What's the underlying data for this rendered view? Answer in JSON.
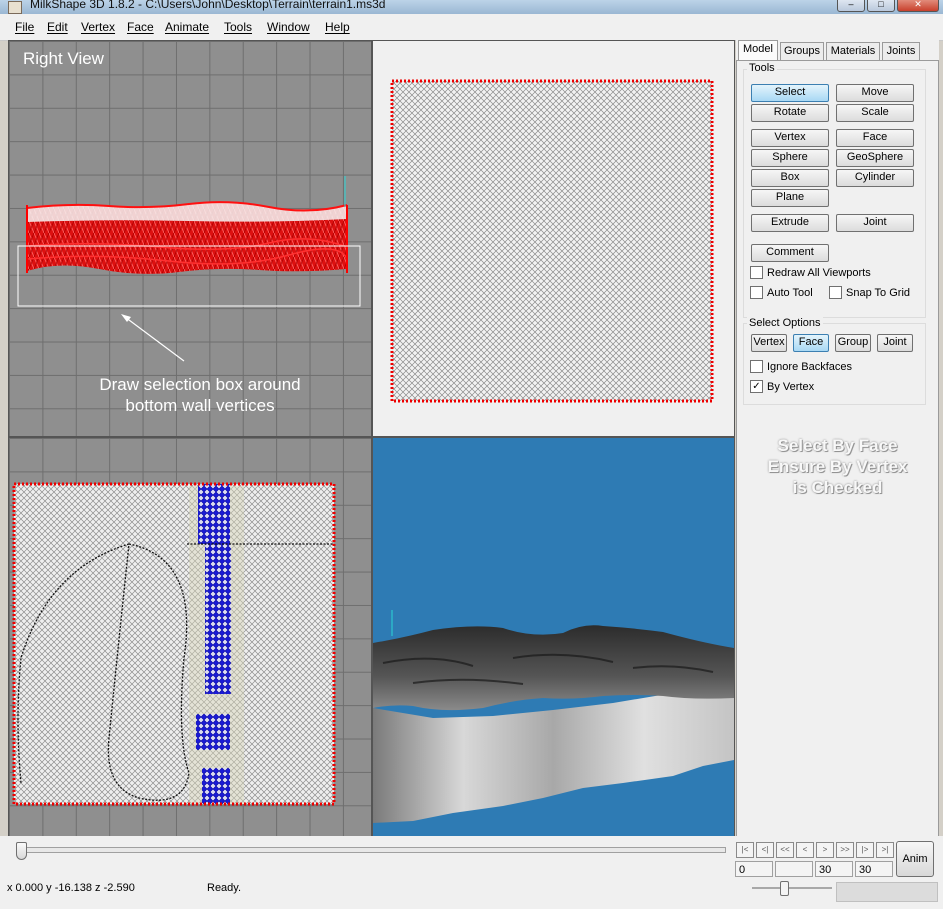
{
  "window": {
    "title": "MilkShape 3D 1.8.2 - C:\\Users\\John\\Desktop\\Terrain\\terrain1.ms3d"
  },
  "menu": [
    "File",
    "Edit",
    "Vertex",
    "Face",
    "Animate",
    "Tools",
    "Window",
    "Help"
  ],
  "viewports": {
    "top_left_label": "Right View",
    "annotation_line1": "Draw selection box around",
    "annotation_line2": "bottom wall vertices"
  },
  "panel": {
    "tabs": [
      "Model",
      "Groups",
      "Materials",
      "Joints"
    ],
    "active_tab": "Model",
    "tools_label": "Tools",
    "tools": {
      "select": "Select",
      "move": "Move",
      "rotate": "Rotate",
      "scale": "Scale",
      "vertex": "Vertex",
      "face": "Face",
      "sphere": "Sphere",
      "geosphere": "GeoSphere",
      "box": "Box",
      "cylinder": "Cylinder",
      "plane": "Plane",
      "extrude": "Extrude",
      "joint": "Joint",
      "comment": "Comment"
    },
    "checkboxes": {
      "redraw": "Redraw All Viewports",
      "auto_tool": "Auto Tool",
      "snap": "Snap To Grid"
    },
    "select_options_label": "Select Options",
    "select_options": {
      "vertex": "Vertex",
      "face": "Face",
      "group": "Group",
      "joint": "Joint"
    },
    "ignore_backfaces": "Ignore Backfaces",
    "by_vertex": "By Vertex",
    "by_vertex_checked": true,
    "note_line1": "Select By Face",
    "note_line2": "Ensure By Vertex",
    "note_line3": "is Checked"
  },
  "timeline": {
    "buttons": [
      "|<",
      "<|",
      "<<",
      "<",
      ">",
      ">>",
      "|>",
      ">|"
    ],
    "frame_start": "0",
    "frame_current": "30",
    "frame_end": "30",
    "anim_label": "Anim"
  },
  "status": {
    "coords": "x 0.000 y -16.138 z -2.590",
    "message": "Ready."
  },
  "colors": {
    "viewport_bg": "#8f8f8f",
    "sky": "#2e7bb4",
    "selected": "#ff0000",
    "blue_faces": "#2020d0"
  }
}
